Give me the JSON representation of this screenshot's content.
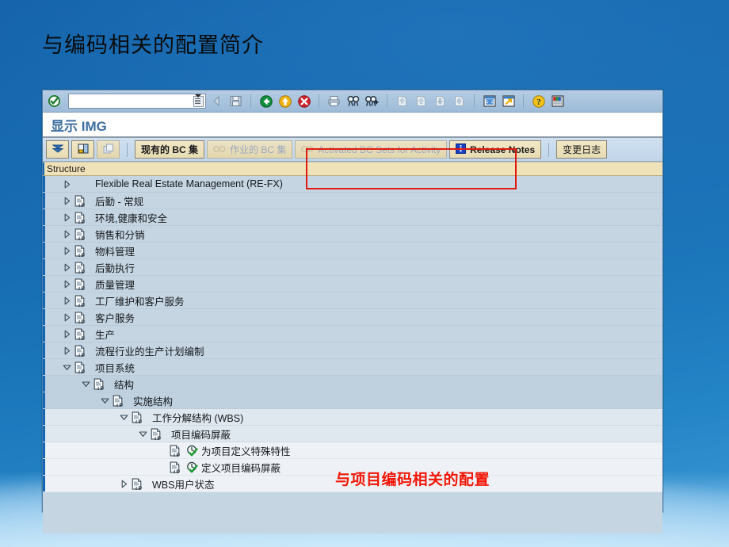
{
  "slide": {
    "title": "与编码相关的配置简介",
    "background_top_color": "#0f5ca5",
    "background_bottom_color": "#3e9ad6"
  },
  "window": {
    "title": "显示 IMG",
    "command_field_value": "",
    "command_field_placeholder": ""
  },
  "toolbar": {
    "icons": [
      {
        "name": "enter-check-icon",
        "label": "Enter"
      },
      {
        "name": "back-arrow-icon",
        "label": "Back"
      },
      {
        "name": "save-icon",
        "label": "Save"
      },
      {
        "name": "back-green-icon",
        "label": "Back"
      },
      {
        "name": "exit-yellow-icon",
        "label": "Exit"
      },
      {
        "name": "cancel-red-icon",
        "label": "Cancel"
      },
      {
        "name": "print-icon",
        "label": "Print"
      },
      {
        "name": "find-icon",
        "label": "Find"
      },
      {
        "name": "find-next-icon",
        "label": "Find Next"
      },
      {
        "name": "first-page-icon",
        "label": "First Page"
      },
      {
        "name": "previous-page-icon",
        "label": "Previous Page"
      },
      {
        "name": "next-page-icon",
        "label": "Next Page"
      },
      {
        "name": "last-page-icon",
        "label": "Last Page"
      },
      {
        "name": "new-session-icon",
        "label": "Create New Session"
      },
      {
        "name": "shortcut-icon",
        "label": "Create Shortcut"
      },
      {
        "name": "help-icon",
        "label": "Help"
      },
      {
        "name": "layout-menu-icon",
        "label": "Customize Local Layout"
      }
    ]
  },
  "app_toolbar": {
    "buttons": [
      {
        "name": "collapse-icon",
        "label": "",
        "icon": "collapse-node-icon",
        "enabled": true
      },
      {
        "name": "expand-icon",
        "label": "",
        "icon": "expand-node-icon",
        "enabled": true
      },
      {
        "name": "copy-icon",
        "label": "",
        "icon": "copy-node-icon",
        "enabled": false
      },
      {
        "name": "existing-bc-sets",
        "label": "现有的 BC 集",
        "icon": "bcset-icon",
        "enabled": true
      },
      {
        "name": "active-bc-sets",
        "label": "作业的 BC 集",
        "icon": "glasses-icon",
        "enabled": false
      },
      {
        "name": "activated-bc-sets-for-activity",
        "label": "Activated BC Sets for Activity",
        "icon": "glasses-icon",
        "enabled": false
      },
      {
        "name": "release-notes",
        "label": "Release Notes",
        "icon": "info-blue-icon",
        "enabled": true
      },
      {
        "name": "change-log",
        "label": "变更日志",
        "icon": "",
        "enabled": true
      }
    ]
  },
  "structure": {
    "column_header": "Structure",
    "rows": [
      {
        "label": "Flexible Real Estate Management (RE-FX)",
        "indent": 0,
        "twisty": "collapsed",
        "icon": "none",
        "shade": "normal"
      },
      {
        "label": "后勤 - 常规",
        "indent": 0,
        "twisty": "collapsed",
        "icon": "doc",
        "shade": "normal"
      },
      {
        "label": "环境,健康和安全",
        "indent": 0,
        "twisty": "collapsed",
        "icon": "doc",
        "shade": "normal"
      },
      {
        "label": "销售和分销",
        "indent": 0,
        "twisty": "collapsed",
        "icon": "doc",
        "shade": "normal"
      },
      {
        "label": "物料管理",
        "indent": 0,
        "twisty": "collapsed",
        "icon": "doc",
        "shade": "normal"
      },
      {
        "label": "后勤执行",
        "indent": 0,
        "twisty": "collapsed",
        "icon": "doc",
        "shade": "normal"
      },
      {
        "label": "质量管理",
        "indent": 0,
        "twisty": "collapsed",
        "icon": "doc",
        "shade": "normal"
      },
      {
        "label": "工厂维护和客户服务",
        "indent": 0,
        "twisty": "collapsed",
        "icon": "doc",
        "shade": "normal"
      },
      {
        "label": "客户服务",
        "indent": 0,
        "twisty": "collapsed",
        "icon": "doc",
        "shade": "normal"
      },
      {
        "label": "生产",
        "indent": 0,
        "twisty": "collapsed",
        "icon": "doc",
        "shade": "normal"
      },
      {
        "label": "流程行业的生产计划编制",
        "indent": 0,
        "twisty": "collapsed",
        "icon": "doc",
        "shade": "normal"
      },
      {
        "label": "项目系统",
        "indent": 0,
        "twisty": "expanded",
        "icon": "doc",
        "shade": "normal"
      },
      {
        "label": "结构",
        "indent": 1,
        "twisty": "expanded",
        "icon": "doc",
        "shade": "alt"
      },
      {
        "label": "实施结构",
        "indent": 2,
        "twisty": "expanded",
        "icon": "doc",
        "shade": "alt"
      },
      {
        "label": "工作分解结构 (WBS)",
        "indent": 3,
        "twisty": "expanded",
        "icon": "doc",
        "shade": "lite"
      },
      {
        "label": "项目编码屏蔽",
        "indent": 4,
        "twisty": "expanded",
        "icon": "doc",
        "shade": "lite"
      },
      {
        "label": "为项目定义特殊特性",
        "indent": 5,
        "twisty": "none",
        "icon": "doc-exec",
        "shade": "pale"
      },
      {
        "label": "定义项目编码屏蔽",
        "indent": 5,
        "twisty": "none",
        "icon": "doc-exec",
        "shade": "pale"
      },
      {
        "label": "WBS用户状态",
        "indent": 3,
        "twisty": "collapsed",
        "icon": "doc",
        "shade": "pale"
      }
    ]
  },
  "annotation": {
    "text": "与项目编码相关的配置",
    "color": "#f41505",
    "box_border_color": "#e01b0e"
  }
}
